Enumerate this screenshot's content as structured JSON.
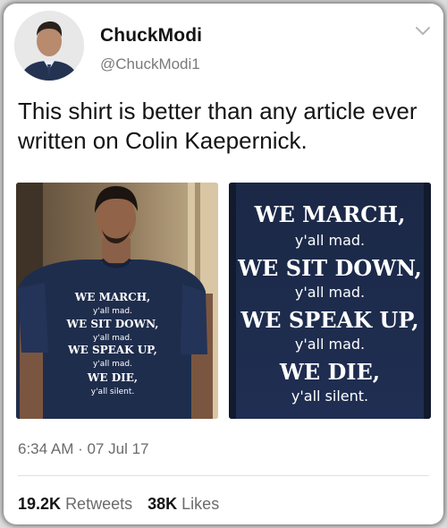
{
  "tweet": {
    "author": {
      "display_name": "ChuckModi",
      "handle": "@ChuckModi1",
      "avatar_icon": "person-avatar-icon"
    },
    "menu_icon": "chevron-down-icon",
    "text": "This shirt is better than any article ever written on Colin Kaepernick.",
    "timestamp": "6:34 AM · 07 Jul 17",
    "stats": {
      "retweets_count": "19.2K",
      "retweets_label": "Retweets",
      "likes_count": "38K",
      "likes_label": "Likes"
    }
  },
  "media": [
    {
      "id": "photo-left",
      "shirt_lines": [
        "WE MARCH,",
        "y'all mad.",
        "WE SIT DOWN,",
        "y'all mad.",
        "WE SPEAK UP,",
        "y'all mad.",
        "WE DIE,",
        "y'all silent."
      ]
    },
    {
      "id": "photo-right",
      "shirt_lines": [
        "WE MARCH,",
        "y'all mad.",
        "WE SIT DOWN,",
        "y'all mad.",
        "WE SPEAK UP,",
        "y'all mad.",
        "WE DIE,",
        "y'all silent."
      ]
    }
  ],
  "colors": {
    "text_primary": "#141414",
    "text_secondary": "#6b6b6b",
    "shirt_navy": "#1f2d4d",
    "card_bg": "#ffffff"
  }
}
